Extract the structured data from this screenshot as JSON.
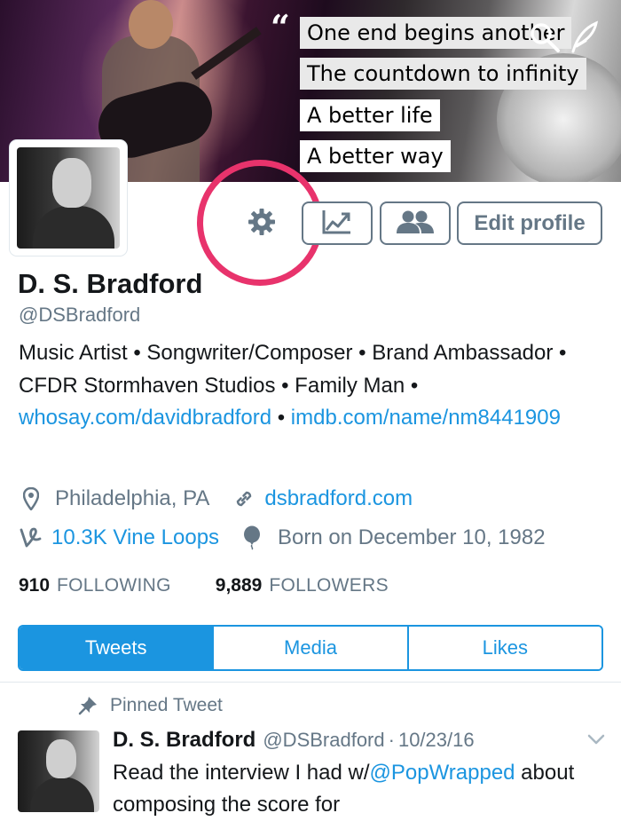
{
  "header": {
    "quote_lines": [
      "One end begins another",
      "The countdown to infinity",
      "A better life",
      "A better way"
    ]
  },
  "actions": {
    "edit_profile_label": "Edit profile"
  },
  "profile": {
    "name": "D. S. Bradford",
    "handle": "@DSBradford",
    "bio_text": "Music Artist • Songwriter/Composer • Brand Ambassador • CFDR Stormhaven Studios • Family Man • ",
    "bio_link1": "whosay.com/davidbradford",
    "bio_separator": " • ",
    "bio_link2": "imdb.com/name/nm8441909",
    "location": "Philadelphia, PA",
    "website": "dsbradford.com",
    "vine_loops": "10.3K Vine Loops",
    "birthday": "Born on December 10, 1982",
    "following_count": "910",
    "following_label": "FOLLOWING",
    "followers_count": "9,889",
    "followers_label": "FOLLOWERS"
  },
  "tabs": [
    {
      "label": "Tweets",
      "active": true
    },
    {
      "label": "Media",
      "active": false
    },
    {
      "label": "Likes",
      "active": false
    }
  ],
  "pinned_tweet": {
    "pinned_label": "Pinned Tweet",
    "author_name": "D. S. Bradford",
    "author_handle": "@DSBradford",
    "separator": "·",
    "date": "10/23/16",
    "text_before": "Read the interview I had w/",
    "mention": "@PopWrapped",
    "text_after": " about composing the score for"
  },
  "colors": {
    "accent": "#1b95e0",
    "highlight_ring": "#e8336c",
    "secondary_text": "#657786"
  }
}
